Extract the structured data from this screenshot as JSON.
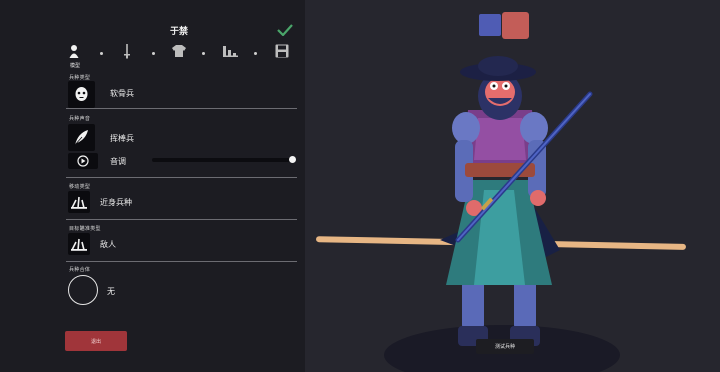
{
  "header": {
    "title": "于禁"
  },
  "tabs": {
    "active_label": "模型"
  },
  "sections": {
    "unit_type": {
      "label": "兵种类型",
      "value": "软骨兵"
    },
    "unit_voice": {
      "label": "兵种声音",
      "value": "挥棒兵",
      "pitch_label": "音调",
      "pitch_level": 1.0
    },
    "movement": {
      "label": "移动类型",
      "value": "近身兵种"
    },
    "targeting": {
      "label": "目标瞄准类型",
      "value": "敌人"
    },
    "combo": {
      "label": "兵种合体",
      "value": "无"
    }
  },
  "buttons": {
    "exit": "退出",
    "test_unit": "测试兵种"
  },
  "team_colors": {
    "blue": "#4f5cb4",
    "red": "#c35d58"
  },
  "icons": [
    "person-icon",
    "sword-icon",
    "shirt-icon",
    "chart-icon",
    "save-icon",
    "check-icon",
    "mask-icon",
    "feather-icon",
    "play-icon",
    "melee-icon",
    "target-icon"
  ]
}
